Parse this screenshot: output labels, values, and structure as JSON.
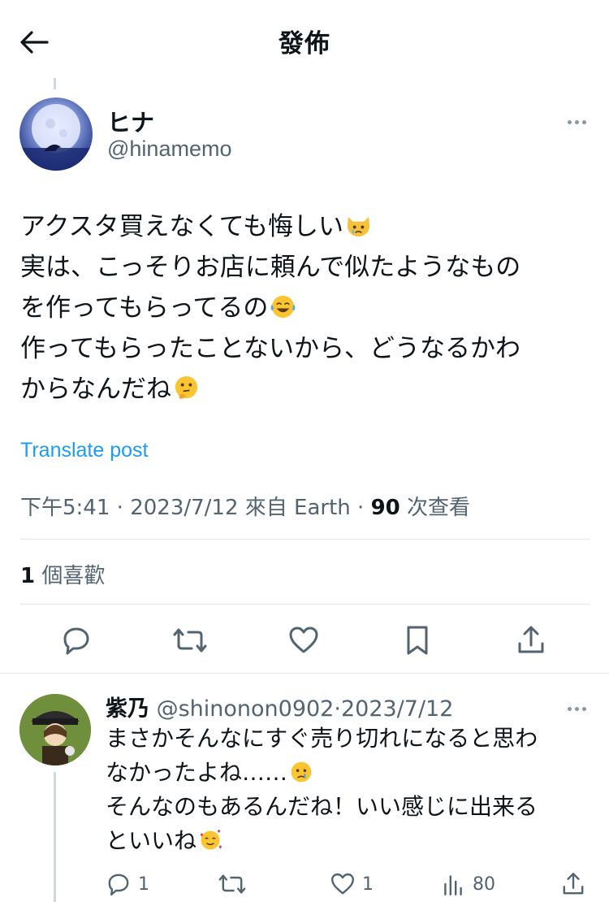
{
  "header": {
    "title": "發佈",
    "back_icon": "back-arrow-icon"
  },
  "post": {
    "author_name": "ヒナ",
    "author_handle": "@hinamemo",
    "text_lines": [
      "アクスタ買えなくても悔しい",
      "実は、こっそりお店に頼んで似たようなもの",
      "を作ってもらってるの",
      "作ってもらったことないから、どうなるかわ",
      "からなんだね"
    ],
    "emojis": [
      "crying-cat-emoji",
      "laughing-tears-emoji",
      "thinking-face-emoji"
    ],
    "translate_label": "Translate post",
    "meta": {
      "time": "下午5:41",
      "separator": " · ",
      "date": "2023/7/12",
      "source": "來自 Earth",
      "views_count": "90",
      "views_label": " 次查看"
    },
    "likes": {
      "count": "1",
      "label": " 個喜歡"
    },
    "actions": [
      "reply-icon",
      "repost-icon",
      "like-icon",
      "bookmark-icon",
      "share-icon"
    ]
  },
  "reply": {
    "author_name": "紫乃",
    "author_handle": "@shinonon0902",
    "separator": "·",
    "date": "2023/7/12",
    "text_lines": [
      "まさかそんなにすぐ売り切れになると思わ",
      "なかったよね……",
      "そんなのもあるんだね！いい感じに出来る",
      "といいね"
    ],
    "emojis": [
      "crying-face-emoji",
      "smiling-hearts-emoji"
    ],
    "stats": {
      "replies": "1",
      "reposts": "",
      "likes": "1",
      "views": "80"
    }
  },
  "colors": {
    "accent": "#1d9bf0",
    "secondary_text": "#536471",
    "divider": "#e1e5e8",
    "thread_line": "#cfd9de"
  }
}
